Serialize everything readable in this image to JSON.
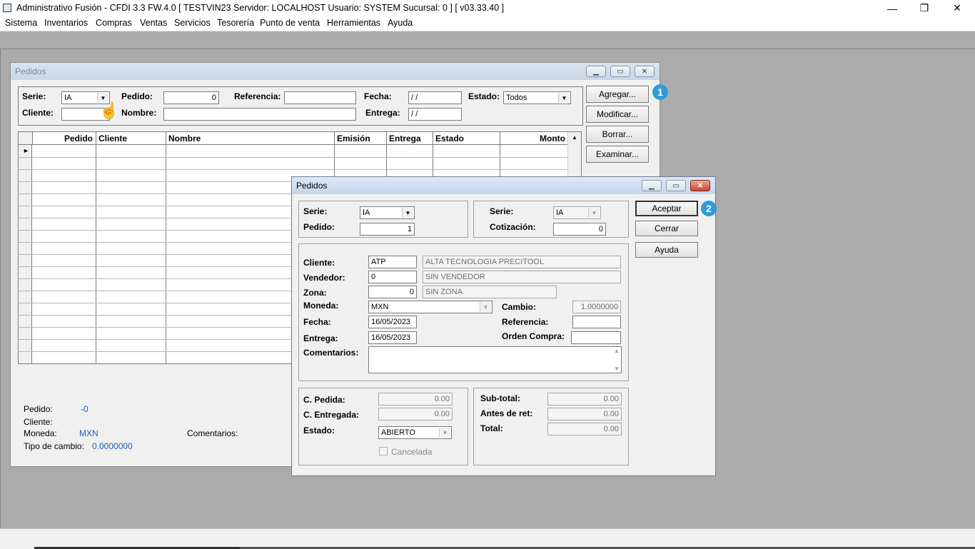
{
  "app": {
    "title": "Administrativo Fusión - CFDI 3.3 FW.4.0 [ TESTVIN23   Servidor: LOCALHOST   Usuario: SYSTEM    Sucursal: 0 ] [ v03.33.40 ]",
    "minimize": "—",
    "restore": "❐",
    "close": "✕"
  },
  "menu": [
    "Sistema",
    "Inventarios",
    "Compras",
    "Ventas",
    "Servicios",
    "Tesorería",
    "Punto de venta",
    "Herramientas",
    "Ayuda"
  ],
  "back_window": {
    "title": "Pedidos",
    "filters": {
      "serie_label": "Serie:",
      "serie_value": "IA",
      "pedido_label": "Pedido:",
      "pedido_value": "0",
      "referencia_label": "Referencia:",
      "referencia_value": "",
      "fecha_label": "Fecha:",
      "fecha_value": " / /",
      "estado_label": "Estado:",
      "estado_value": "Todos",
      "cliente_label": "Cliente:",
      "cliente_value": "",
      "nombre_label": "Nombre:",
      "nombre_value": "",
      "entrega_label": "Entrega:",
      "entrega_value": " / /"
    },
    "buttons": [
      "Agregar...",
      "Modificar...",
      "Borrar...",
      "Examinar..."
    ],
    "grid_columns": [
      "Pedido",
      "Cliente",
      "Nombre",
      "Emisión",
      "Entrega",
      "Estado",
      "Monto"
    ],
    "current_row_marker": "►",
    "footer": {
      "pedido_label": "Pedido:",
      "pedido_value": "-0",
      "cliente_label": "Cliente:",
      "moneda_label": "Moneda:",
      "moneda_value": "MXN",
      "tipo_cambio_label": "Tipo de cambio:",
      "tipo_cambio_value": "0.0000000",
      "comentarios_label": "Comentarios:"
    }
  },
  "dialog": {
    "title": "Pedidos",
    "serie_label": "Serie:",
    "serie_value": "IA",
    "pedido_label": "Pedido:",
    "pedido_value": "1",
    "cot_serie_label": "Serie:",
    "cot_serie_value": "IA",
    "cotizacion_label": "Cotización:",
    "cotizacion_value": "0",
    "cliente_label": "Cliente:",
    "cliente_code": "ATP",
    "cliente_name": "ALTA TECNOLOGIA PRECITOOL",
    "vendedor_label": "Vendedor:",
    "vendedor_code": "0",
    "vendedor_name": "SIN VENDEDOR",
    "zona_label": "Zona:",
    "zona_code": "0",
    "zona_name": "SIN ZONA",
    "moneda_label": "Moneda:",
    "moneda_value": "MXN",
    "cambio_label": "Cambio:",
    "cambio_value": "1.0000000",
    "fecha_label": "Fecha:",
    "fecha_value": "16/05/2023",
    "referencia_label": "Referencia:",
    "referencia_value": "",
    "entrega_label": "Entrega:",
    "entrega_value": "16/05/2023",
    "orden_compra_label": "Orden Compra:",
    "orden_compra_value": "",
    "comentarios_label": "Comentarios:",
    "comentarios_value": "",
    "c_pedida_label": "C. Pedida:",
    "c_pedida_value": "0.00",
    "c_entregada_label": "C. Entregada:",
    "c_entregada_value": "0.00",
    "estado_label": "Estado:",
    "estado_value": "ABIERTO",
    "cancelada_label": "Cancelada",
    "subtotal_label": "Sub-total:",
    "subtotal_value": "0.00",
    "antes_ret_label": "Antes de ret:",
    "antes_ret_value": "0.00",
    "total_label": "Total:",
    "total_value": "0.00",
    "aceptar": "Aceptar",
    "cerrar": "Cerrar",
    "ayuda": "Ayuda"
  },
  "badges": [
    "1",
    "2"
  ]
}
